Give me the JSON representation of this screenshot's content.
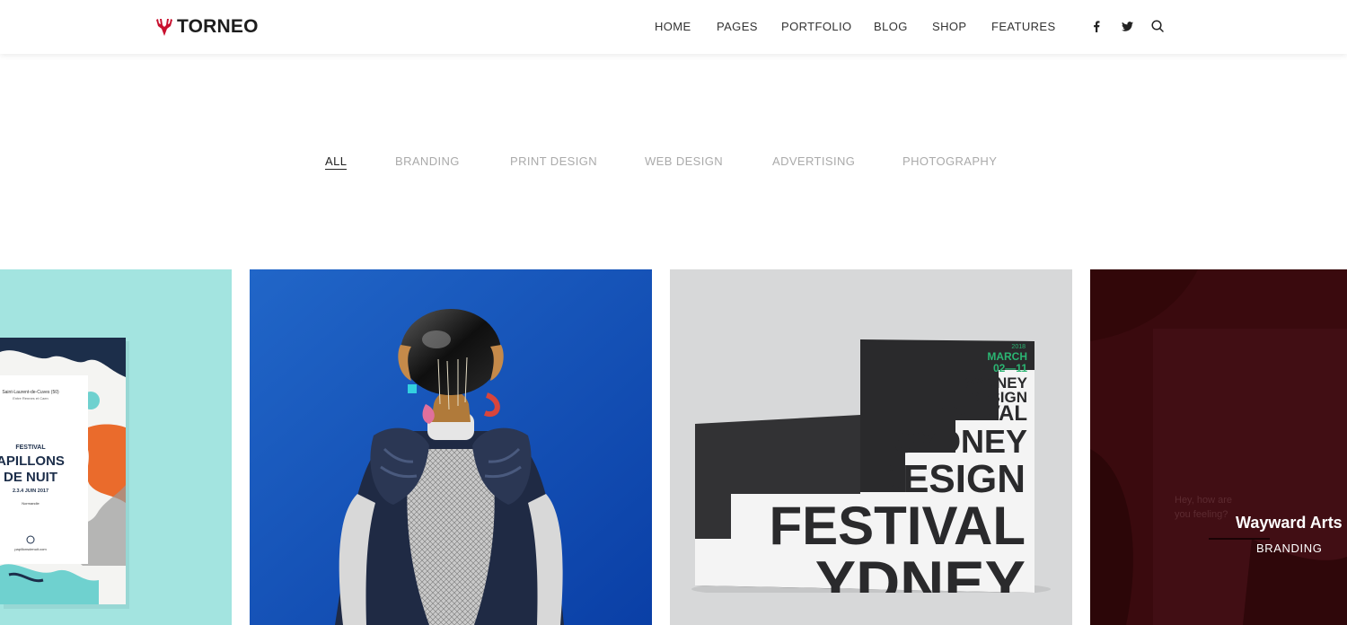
{
  "brand": {
    "name": "TORNEO",
    "accent": "#c8102e"
  },
  "nav": {
    "items": [
      {
        "label": "HOME"
      },
      {
        "label": "PAGES"
      },
      {
        "label": "PORTFOLIO"
      },
      {
        "label": "BLOG"
      },
      {
        "label": "SHOP"
      },
      {
        "label": "FEATURES"
      }
    ],
    "social": [
      "facebook-icon",
      "twitter-icon",
      "search-icon"
    ]
  },
  "filters": {
    "active": "ALL",
    "items": [
      {
        "label": "ALL"
      },
      {
        "label": "BRANDING"
      },
      {
        "label": "PRINT DESIGN"
      },
      {
        "label": "WEB DESIGN"
      },
      {
        "label": "ADVERTISING"
      },
      {
        "label": "PHOTOGRAPHY"
      }
    ]
  },
  "portfolio": {
    "cards": [
      {
        "image": "papillons-de-nuit-poster",
        "poster": {
          "location": "Saint-Laurent-de-Cuves (50)",
          "sublocation": "Entre Rennes et Caen",
          "kicker": "FESTIVAL",
          "line1": "APILLONS",
          "line2": "DE NUIT",
          "dates": "2.3.4 JUIN 2017",
          "town": "Normandie",
          "site": "papillonsdenuit.com"
        }
      },
      {
        "image": "robot-figure-blue-background"
      },
      {
        "image": "sydney-design-festival-book",
        "book": {
          "year": "2018",
          "month": "MARCH",
          "dates": "02—11",
          "small1": "SYDNEY",
          "small2": "DESIGN",
          "small3": "FESTIVAL",
          "big1": "SYDNEY",
          "big2": "DESIGN",
          "big3": "FESTIVAL",
          "big4": "YDNEY"
        }
      },
      {
        "image": "wayward-arts-dark-red",
        "title": "Wayward Arts",
        "category": "BRANDING",
        "faint_text": [
          "Hey, how are",
          "you feeling?"
        ]
      }
    ]
  }
}
